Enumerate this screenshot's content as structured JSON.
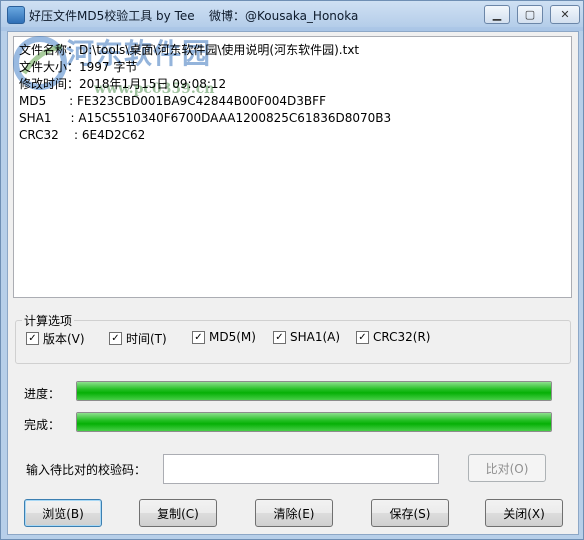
{
  "window": {
    "title": "好压文件MD5校验工具 by Tee",
    "weibo": "微博：@Kousaka_Honoka",
    "minimize": "▁",
    "maximize": "▢",
    "close": "✕"
  },
  "watermark": {
    "text": "河东软件园",
    "url": "www.pc0359.cn"
  },
  "info": {
    "file_name": "文件名称：D:\\tools\\桌面\\河东软件园\\使用说明(河东软件园).txt",
    "file_size": "文件大小：1997 字节",
    "modified": "修改时间：2018年1月15日 09:08:12",
    "md5": "MD5      : FE323CBD001BA9C42844B00F004D3BFF",
    "sha1": "SHA1     : A15C5510340F6700DAAA1200825C61836D8070B3",
    "crc32": "CRC32    : 6E4D2C62"
  },
  "options": {
    "title": "计算选项",
    "version": {
      "label": "版本(V)",
      "checked": true
    },
    "time": {
      "label": "时间(T)",
      "checked": true
    },
    "md5": {
      "label": "MD5(M)",
      "checked": true
    },
    "sha1": {
      "label": "SHA1(A)",
      "checked": true
    },
    "crc32": {
      "label": "CRC32(R)",
      "checked": true
    }
  },
  "progress": {
    "label": "进度：",
    "value": 1.0
  },
  "complete": {
    "label": "完成：",
    "value": 1.0
  },
  "compare": {
    "label": "输入待比对的校验码：",
    "value": "",
    "button": "比对(O)"
  },
  "buttons": {
    "browse": "浏览(B)",
    "copy": "复制(C)",
    "clear": "清除(E)",
    "save": "保存(S)",
    "close": "关闭(X)"
  },
  "colors": {
    "progress_fill": "#06b006",
    "title_bar": "#b4cde9"
  }
}
